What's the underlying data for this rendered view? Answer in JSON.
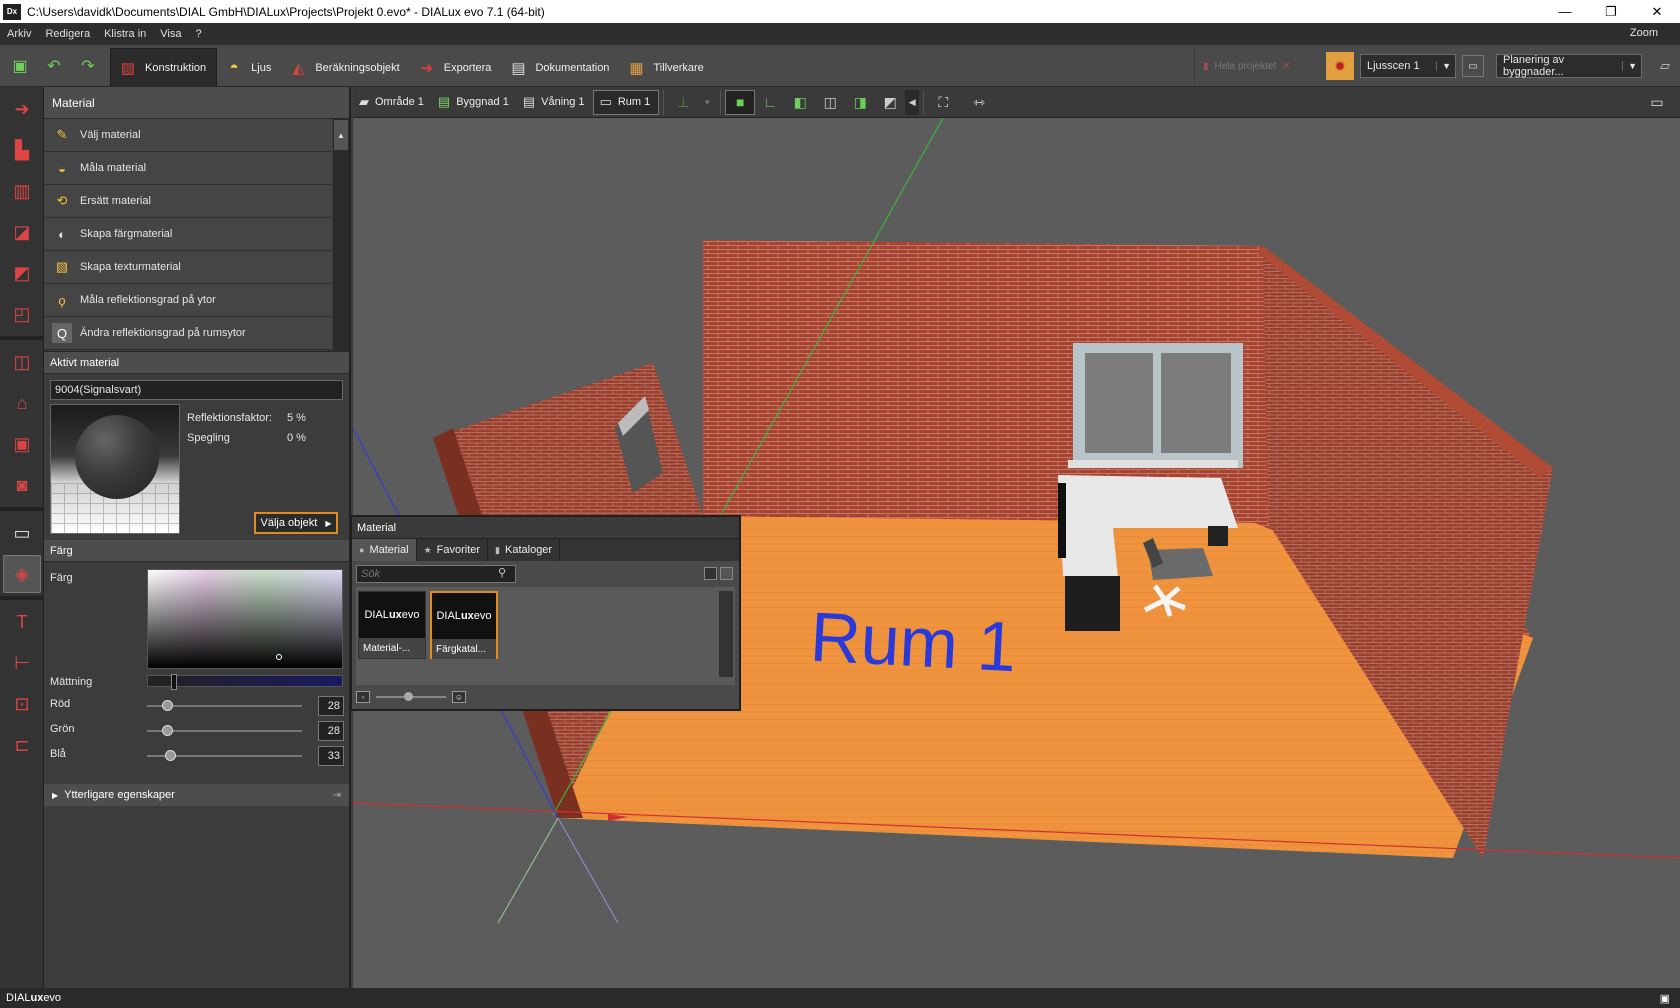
{
  "window": {
    "title": "C:\\Users\\davidk\\Documents\\DIAL GmbH\\DIALux\\Projects\\Projekt 0.evo* - DIALux evo 7.1  (64-bit)",
    "app_icon": "Dx",
    "minimize": "—",
    "restore": "❐",
    "close": "✕"
  },
  "menu": {
    "items": [
      "Arkiv",
      "Redigera",
      "Klistra in",
      "Visa",
      "?"
    ],
    "zoom": "Zoom"
  },
  "ribbon": {
    "tabs": [
      {
        "label": "Konstruktion",
        "icon": "construction-icon"
      },
      {
        "label": "Ljus",
        "icon": "lamp-icon"
      },
      {
        "label": "Beräkningsobjekt",
        "icon": "calc-object-icon"
      },
      {
        "label": "Exportera",
        "icon": "export-icon"
      },
      {
        "label": "Dokumentation",
        "icon": "document-icon"
      },
      {
        "label": "Tillverkare",
        "icon": "manufacturer-icon"
      }
    ],
    "disabled_tool": "Hela projektet",
    "light_scene": "Ljusscen 1",
    "planning_mode": "Planering av byggnader..."
  },
  "material_panel": {
    "title": "Material",
    "items": [
      {
        "label": "Välj material",
        "icon": "pipette-icon"
      },
      {
        "label": "Måla material",
        "icon": "paint-bucket-icon"
      },
      {
        "label": "Ersätt material",
        "icon": "replace-icon"
      },
      {
        "label": "Skapa färgmaterial",
        "icon": "palette-icon"
      },
      {
        "label": "Skapa texturmaterial",
        "icon": "texture-icon"
      },
      {
        "label": "Måla reflektionsgrad på ytor",
        "icon": "reflect-paint-icon"
      },
      {
        "label": "Ändra reflektionsgrad på rumsytor",
        "icon": "reflect-room-icon"
      }
    ]
  },
  "active_material": {
    "title": "Aktivt material",
    "name": "9004(Signalsvart)",
    "reflection_label": "Reflektionsfaktor:",
    "reflection_value": "5 %",
    "specular_label": "Spegling",
    "specular_value": "0 %",
    "select_button": "Välja objekt"
  },
  "color": {
    "title": "Färg",
    "color_label": "Färg",
    "saturation_label": "Mättning",
    "saturation_fraction": 0.12,
    "channels": [
      {
        "label": "Röd",
        "value": "28"
      },
      {
        "label": "Grön",
        "value": "28"
      },
      {
        "label": "Blå",
        "value": "33"
      }
    ],
    "more_properties": "Ytterligare egenskaper"
  },
  "view_toolbar": {
    "breadcrumbs": [
      "Område 1",
      "Byggnad 1",
      "Våning 1",
      "Rum 1"
    ]
  },
  "scene": {
    "room_label": "Rum 1"
  },
  "material_popup": {
    "title": "Material",
    "tabs": [
      "Material",
      "Favoriter",
      "Kataloger"
    ],
    "search_placeholder": "Sök",
    "tiles": [
      {
        "logo_a": "DIAL",
        "logo_b": "ux",
        "logo_c": "evo",
        "caption": "Material-..."
      },
      {
        "logo_a": "DIAL",
        "logo_b": "ux",
        "logo_c": "evo",
        "caption": "Färgkatal..."
      }
    ]
  },
  "status": {
    "brand_a": "DIAL",
    "brand_b": "ux",
    "brand_c": "evo"
  },
  "colors": {
    "accent": "#e08a20",
    "room_label": "#2a3ad8",
    "brick": "#a8432f",
    "floor": "#f0933e"
  }
}
